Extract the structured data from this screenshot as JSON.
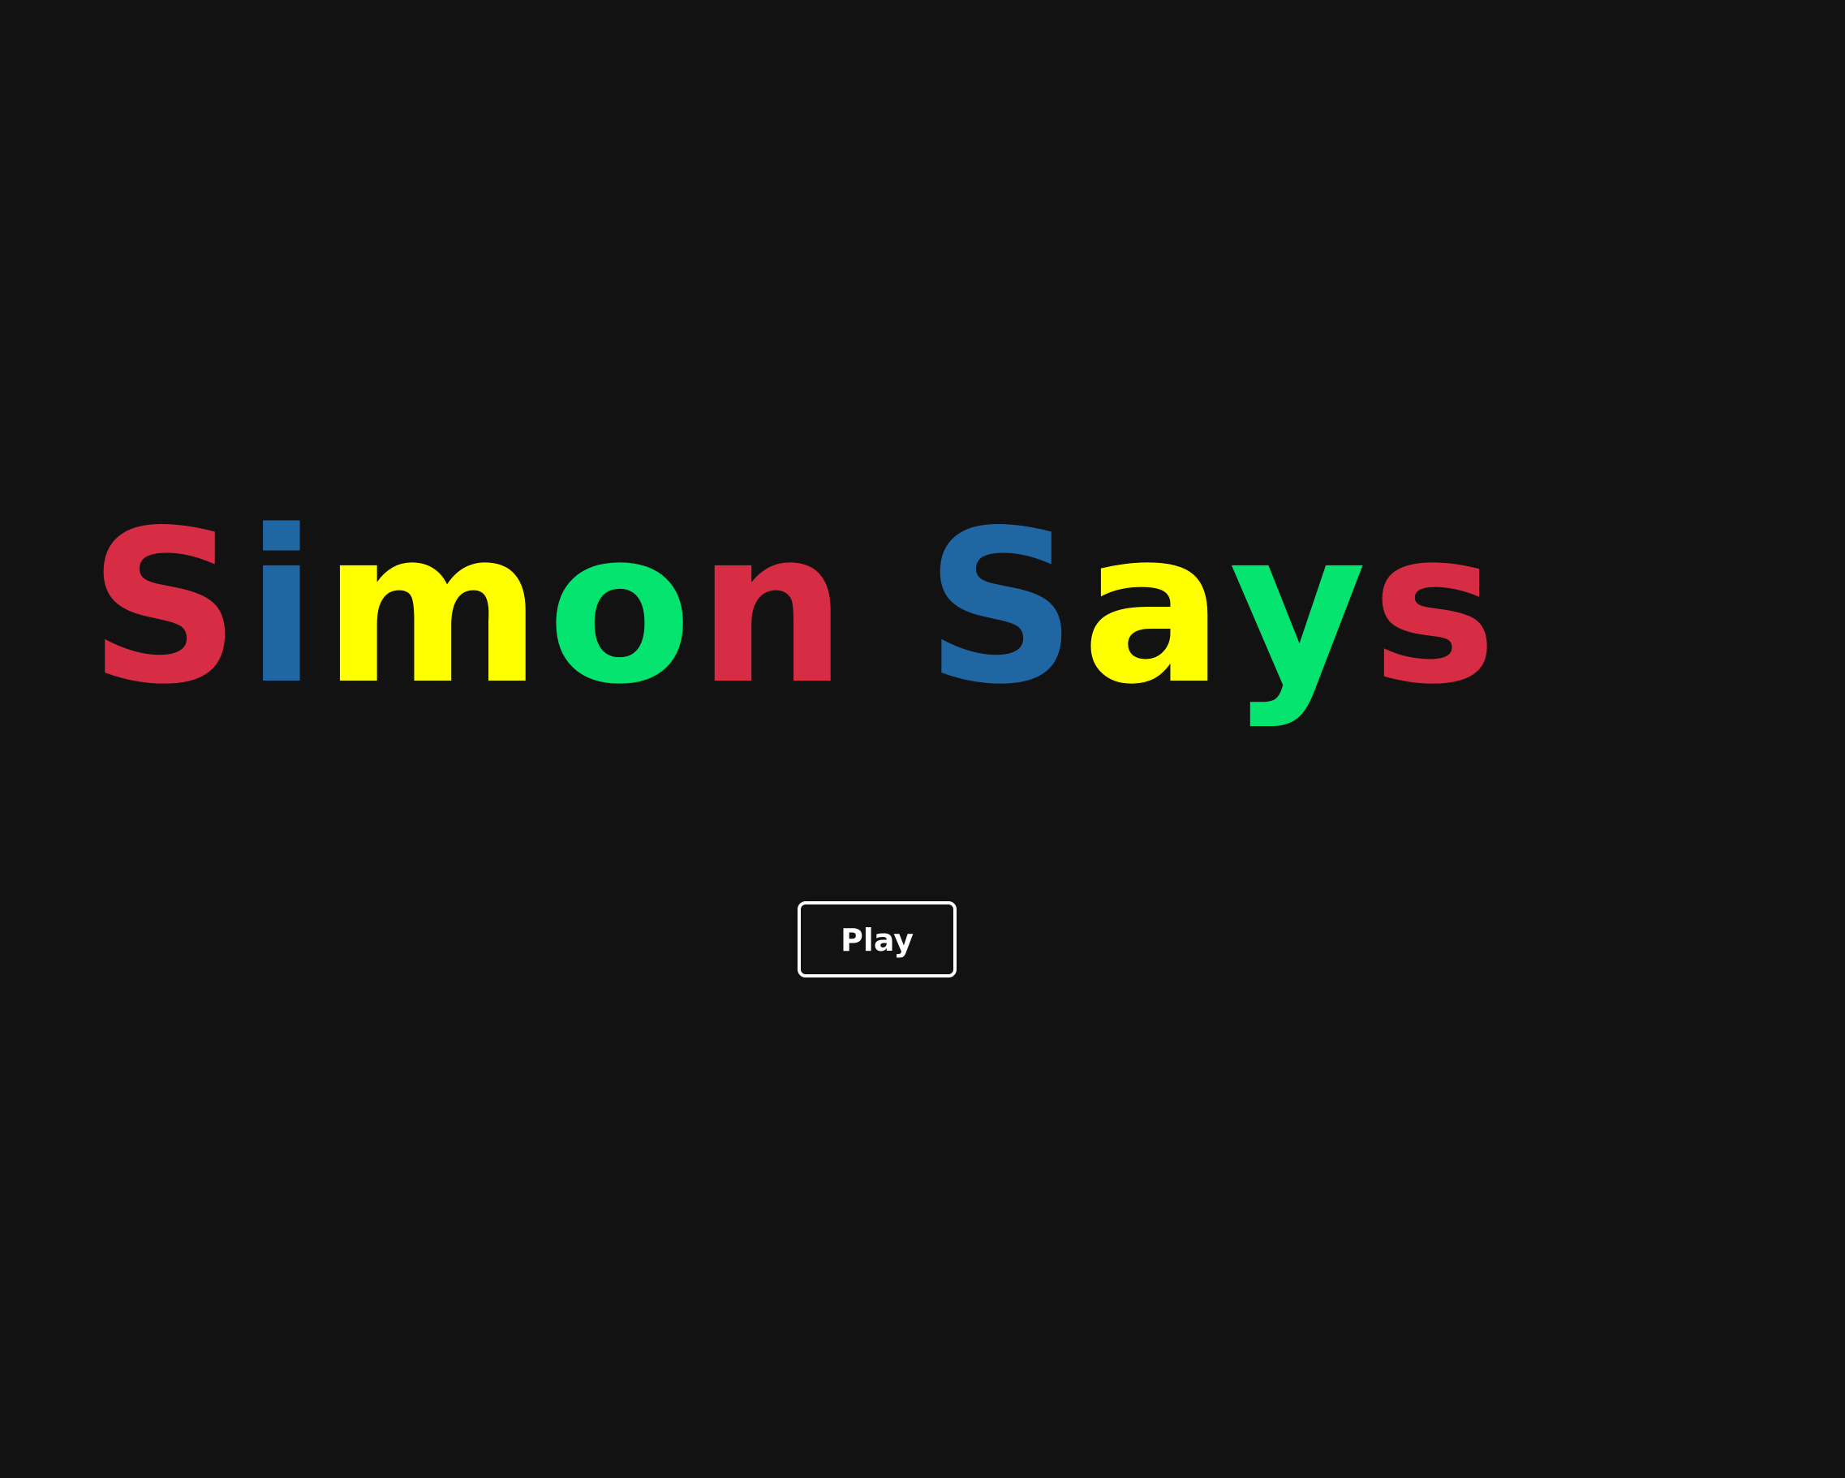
{
  "title": {
    "letters": [
      {
        "char": "S",
        "color": "#d62d45"
      },
      {
        "char": "i",
        "color": "#1f66a3"
      },
      {
        "char": "m",
        "color": "#ffff00"
      },
      {
        "char": "o",
        "color": "#05e46e"
      },
      {
        "char": "n",
        "color": "#d62d45"
      },
      {
        "char": " ",
        "color": ""
      },
      {
        "char": "S",
        "color": "#1f66a3"
      },
      {
        "char": "a",
        "color": "#ffff00"
      },
      {
        "char": "y",
        "color": "#05e46e"
      },
      {
        "char": "s",
        "color": "#d62d45"
      }
    ]
  },
  "play_button": {
    "label": "Play",
    "border_color": "#ffffff",
    "text_color": "#ffffff"
  },
  "background_color": "#121212"
}
